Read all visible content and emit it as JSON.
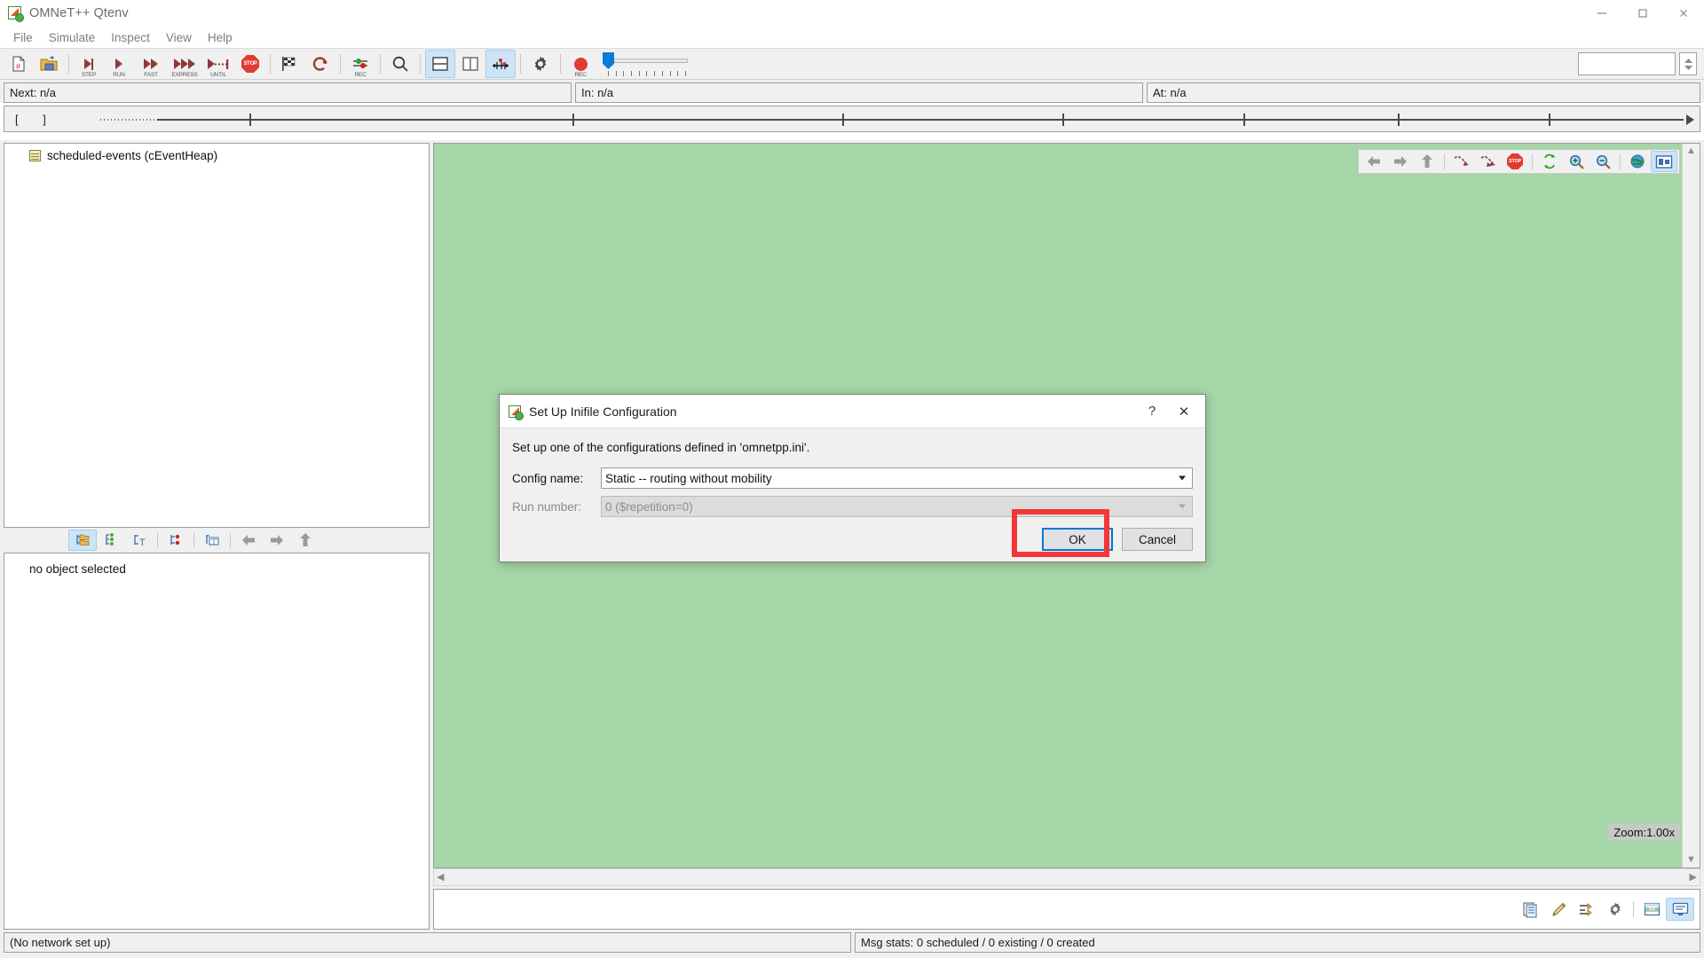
{
  "window": {
    "title": "OMNeT++ Qtenv",
    "app_icon": "omnet-logo-icon",
    "controls": {
      "minimize": "minimize-icon",
      "maximize": "maximize-icon",
      "close": "close-icon"
    }
  },
  "menubar": {
    "items": [
      {
        "label": "File"
      },
      {
        "label": "Simulate"
      },
      {
        "label": "Inspect"
      },
      {
        "label": "View"
      },
      {
        "label": "Help"
      }
    ]
  },
  "toolbar": {
    "buttons": [
      {
        "name": "new-run-icon",
        "label": ""
      },
      {
        "name": "open-folder-icon",
        "label": ""
      },
      {
        "name": "step-icon",
        "label": "STEP"
      },
      {
        "name": "run-icon",
        "label": "RUN"
      },
      {
        "name": "fast-run-icon",
        "label": "FAST"
      },
      {
        "name": "express-run-icon",
        "label": "EXPRESS"
      },
      {
        "name": "run-until-icon",
        "label": "UNTIL"
      },
      {
        "name": "stop-icon",
        "label": ""
      },
      {
        "name": "finish-flag-icon",
        "label": ""
      },
      {
        "name": "rebuild-network-icon",
        "label": ""
      },
      {
        "name": "event-log-record-icon",
        "label": "REC"
      },
      {
        "name": "find-object-icon",
        "label": ""
      },
      {
        "name": "horizontal-layout-icon",
        "label": ""
      },
      {
        "name": "vertical-layout-icon",
        "label": ""
      },
      {
        "name": "timeline-toggle-icon",
        "label": ""
      },
      {
        "name": "preferences-gear-icon",
        "label": ""
      },
      {
        "name": "record-animation-icon",
        "label": "REC"
      }
    ],
    "speed_slider": {
      "name": "animation-speed-slider",
      "value": 0,
      "ticks": 11
    },
    "text_field": {
      "value": "",
      "placeholder": ""
    },
    "spinner": {
      "name": "spinner-stepper"
    }
  },
  "status": {
    "next": "Next: n/a",
    "in": "In: n/a",
    "at": "At: n/a"
  },
  "timeline": {
    "brackets_left": "[",
    "brackets_right": "]"
  },
  "tree": {
    "items": [
      {
        "label": "scheduled-events (cEventHeap)",
        "icon": "event-heap-icon"
      }
    ],
    "toolbar": [
      {
        "name": "tree-mode-flat-icon",
        "active": true
      },
      {
        "name": "tree-mode-grouped-icon",
        "active": false
      },
      {
        "name": "tree-mode-inheritance-icon",
        "active": false
      },
      {
        "name": "tree-mode-children-icon",
        "active": false
      },
      {
        "name": "tree-mode-table-icon",
        "active": false
      },
      {
        "name": "nav-back-icon",
        "active": false
      },
      {
        "name": "nav-forward-icon",
        "active": false
      },
      {
        "name": "nav-up-icon",
        "active": false
      }
    ]
  },
  "detail": {
    "empty_text": "no object selected"
  },
  "canvas": {
    "background_color": "#a5d6a7",
    "zoom_label": "Zoom:1.00x",
    "toolbar": [
      {
        "name": "nav-back-icon",
        "active": false
      },
      {
        "name": "nav-forward-icon",
        "active": false
      },
      {
        "name": "nav-up-icon",
        "active": false
      },
      {
        "name": "run-until-next-event-icon",
        "active": false
      },
      {
        "name": "fast-run-until-icon",
        "active": false
      },
      {
        "name": "stop-icon",
        "active": false
      },
      {
        "name": "relayout-icon",
        "active": false
      },
      {
        "name": "zoom-in-icon",
        "active": false
      },
      {
        "name": "zoom-out-icon",
        "active": false
      },
      {
        "name": "show-module-icon",
        "active": false
      },
      {
        "name": "display-options-icon",
        "active": true
      }
    ]
  },
  "log": {
    "toolbar": [
      {
        "name": "copy-to-clipboard-icon",
        "active": false
      },
      {
        "name": "filter-pen-icon",
        "active": false
      },
      {
        "name": "filter-messages-icon",
        "active": false
      },
      {
        "name": "log-options-gear-icon",
        "active": false
      },
      {
        "name": "message-table-view-icon",
        "active": false
      },
      {
        "name": "log-view-icon",
        "active": true
      }
    ]
  },
  "bottom_status": {
    "network": "(No network set up)",
    "msg_stats": "Msg stats: 0 scheduled / 0 existing / 0 created"
  },
  "dialog": {
    "title": "Set Up Inifile Configuration",
    "icon": "omnet-logo-icon",
    "help_button": "?",
    "close_button": "✕",
    "description": "Set up one of the configurations defined in 'omnetpp.ini'.",
    "fields": [
      {
        "label": "Config name:",
        "value": "Static -- routing without mobility",
        "disabled": false,
        "name": "config-name-select"
      },
      {
        "label": "Run number:",
        "value": "0 ($repetition=0)",
        "disabled": true,
        "name": "run-number-select"
      }
    ],
    "buttons": [
      {
        "label": "OK",
        "name": "ok-button",
        "default": true
      },
      {
        "label": "Cancel",
        "name": "cancel-button",
        "default": false
      }
    ],
    "highlight_color": "#f4363b",
    "highlight_target": "ok-button"
  }
}
